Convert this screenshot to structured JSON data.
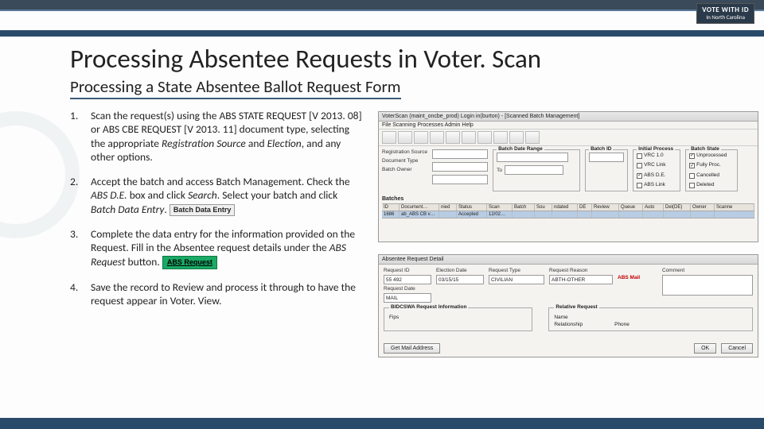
{
  "brand": {
    "line1": "VOTE WITH ID",
    "line2": "In North Carolina"
  },
  "title": "Processing Absentee Requests in Voter. Scan",
  "subtitle": "Processing a State Absentee Ballot Request Form",
  "steps": [
    {
      "num": "1.",
      "html": "Scan the request(s) using the ABS STATE REQUEST [V 2013. 08] or ABS CBE REQUEST [V 2013. 11] document type, selecting the appropriate <span class='em'>Registration Source</span> and <span class='em'>Election</span>, and any other options."
    },
    {
      "num": "2.",
      "html": "Accept the batch and access Batch Management. Check the <span class='em'>ABS D.E.</span> box and click <span class='em'>Search</span>. Select your batch and click <span class='em'>Batch Data Entry</span>. <span class='inline-btn' data-name='batch-data-entry-button' data-interactable='false'>Batch Data Entry</span>"
    },
    {
      "num": "3.",
      "html": "Complete the data entry for the information provided on the Request. Fill in the Absentee request details under the <span class='em'>ABS Request</span> button. <span class='abs-btn' data-name='abs-request-button' data-interactable='false'>ABS Request</span>"
    },
    {
      "num": "4.",
      "html": "Save the record to Review and process it through to have the request appear in Voter. View."
    }
  ],
  "shot1": {
    "title": "VoterScan (maint_oncbe_prod) Login in(burton) - [Scanned Batch Management]",
    "menu": "File   Scanning Processes   Admin   Help",
    "labels": {
      "reg_source": "Registration Source",
      "doc_type": "Document Type",
      "batch_owner": "Batch Owner",
      "date_range": "Batch Date Range",
      "to": "To",
      "batch_id": "Batch ID",
      "initial_process": "Initial Process",
      "batch_state": "Batch State"
    },
    "initial_process": [
      "VRC 1.0",
      "VRC Link",
      "ABS D.E.",
      "ABS Link"
    ],
    "batch_state": [
      "Unprocessed",
      "Fully Proc.",
      "Cancelled",
      "Deleted"
    ],
    "checked_ip": [
      false,
      false,
      true,
      false
    ],
    "checked_bs": [
      true,
      true,
      false,
      false
    ],
    "batches_label": "Batches",
    "grid_headers": [
      "ID",
      "Document…",
      "nied",
      "Status",
      "Scan",
      "Batch",
      "Sou",
      "ndated",
      "DE",
      "Review",
      "Queue",
      "Auto",
      "Del(DE)",
      "Owner",
      "Scanne"
    ],
    "grid_row": [
      "1686",
      "ab_ABS CB v…",
      "",
      "Accepted",
      "12/02…",
      "",
      "",
      "",
      "",
      "",
      "",
      "",
      "",
      "",
      ""
    ]
  },
  "shot2": {
    "title": "Absentee Request Detail",
    "labels": {
      "request_id": "Request ID",
      "election_date": "Election Date",
      "request_type": "Request Type",
      "request_reason": "Request Reason",
      "request_date": "Request Date",
      "abs_mail": "ABS Mail",
      "comment": "Comment",
      "fips": "Fips",
      "relative_request": "Relative Request",
      "name": "Name",
      "relationship": "Relationship",
      "phone": "Phone",
      "bidcswa": "BIDCSWA Request Information"
    },
    "values": {
      "request_id": "55 492",
      "election_date": "03/15/15",
      "request_type": "CIVILIAN",
      "request_reason": "ABTH-OTHER",
      "request_date": "MAIL"
    },
    "buttons": {
      "get_mail": "Get Mail Address",
      "ok": "OK",
      "cancel": "Cancel"
    }
  }
}
